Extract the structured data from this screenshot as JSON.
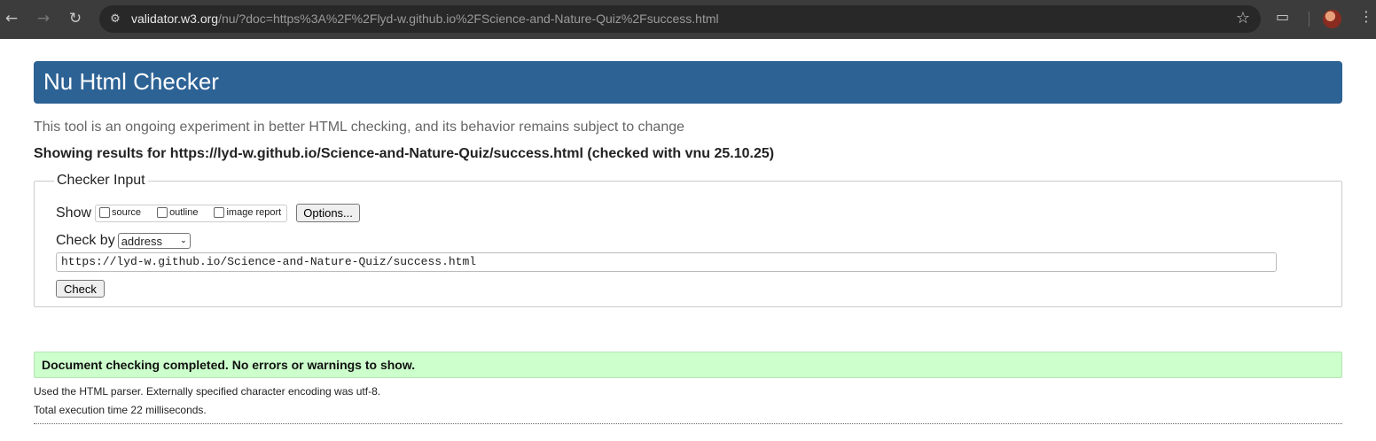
{
  "browser": {
    "url_host": "validator.w3.org",
    "url_rest": "/nu/?doc=https%3A%2F%2Flyd-w.github.io%2FScience-and-Nature-Quiz%2Fsuccess.html",
    "icons": [
      "back-arrow-icon",
      "forward-arrow-icon",
      "reload-icon",
      "site-info-icon",
      "star-icon",
      "search-tab-icon",
      "profile-avatar",
      "menu-dots-icon"
    ]
  },
  "header": {
    "title": "Nu Html Checker",
    "color": "#2d6294"
  },
  "subtitle": "This tool is an ongoing experiment in better HTML checking, and its behavior remains subject to change",
  "results_for": "Showing results for https://lyd-w.github.io/Science-and-Nature-Quiz/success.html (checked with vnu 25.10.25)",
  "checker_input": {
    "legend": "Checker Input",
    "show_label": "Show",
    "show_options": [
      {
        "label": "source",
        "checked": false
      },
      {
        "label": "outline",
        "checked": false
      },
      {
        "label": "image report",
        "checked": false
      }
    ],
    "options_button": "Options...",
    "check_by_label": "Check by",
    "check_by_value": "address",
    "address_value": "https://lyd-w.github.io/Science-and-Nature-Quiz/success.html",
    "check_button": "Check"
  },
  "result": {
    "message": "Document checking completed. No errors or warnings to show.",
    "color": "#ccffcc",
    "parser_info": "Used the HTML parser. Externally specified character encoding was utf-8.",
    "execution_time": "Total execution time 22 milliseconds."
  }
}
